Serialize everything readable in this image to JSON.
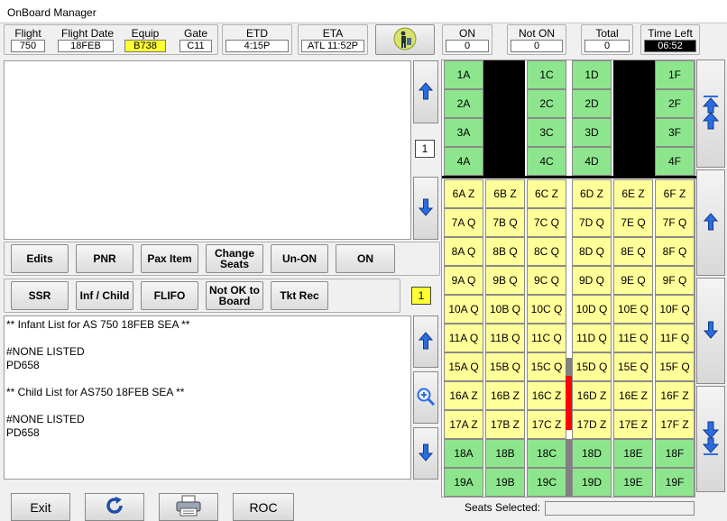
{
  "window": {
    "title": "OnBoard Manager"
  },
  "header": {
    "flight_label": "Flight",
    "flight_value": "750",
    "flight_date_label": "Flight Date",
    "flight_date_value": "18FEB",
    "equip_label": "Equip",
    "equip_value": "B738",
    "gate_label": "Gate",
    "gate_value": "C11",
    "etd_label": "ETD",
    "etd_value": "4:15P",
    "eta_label": "ETA",
    "eta_value": "ATL 11:52P",
    "on_label": "ON",
    "on_value": "0",
    "not_on_label": "Not ON",
    "not_on_value": "0",
    "total_label": "Total",
    "total_value": "0",
    "time_left_label": "Time Left",
    "time_left_value": "06:52",
    "boarding_icon": "passenger-boarding-icon"
  },
  "pager": {
    "top_page": "1",
    "mid_page": "1"
  },
  "buttons_row1": [
    {
      "label": "Edits"
    },
    {
      "label": "PNR"
    },
    {
      "label": "Pax Item"
    },
    {
      "label": "Change Seats"
    },
    {
      "label": "Un-ON"
    },
    {
      "label": "ON"
    }
  ],
  "buttons_row2": [
    {
      "label": "SSR"
    },
    {
      "label": "Inf / Child"
    },
    {
      "label": "FLIFO"
    },
    {
      "label": "Not OK to Board"
    },
    {
      "label": "Tkt Rec"
    }
  ],
  "info_panel": {
    "lines": [
      "** Infant List for AS 750 18FEB SEA **",
      "",
      "#NONE LISTED",
      "PD658",
      "",
      "** Child List for AS750 18FEB SEA **",
      "",
      "#NONE LISTED",
      "PD658"
    ]
  },
  "seatmap": {
    "first_class": [
      [
        "1A",
        "1C",
        "1D",
        "1F"
      ],
      [
        "2A",
        "2C",
        "2D",
        "2F"
      ],
      [
        "3A",
        "3C",
        "3D",
        "3F"
      ],
      [
        "4A",
        "4C",
        "4D",
        "4F"
      ]
    ],
    "main_cabin": [
      [
        "6A Z",
        "6B Z",
        "6C Z",
        "6D Z",
        "6E Z",
        "6F Z"
      ],
      [
        "7A Q",
        "7B Q",
        "7C Q",
        "7D Q",
        "7E Q",
        "7F Q"
      ],
      [
        "8A Q",
        "8B Q",
        "8C Q",
        "8D Q",
        "8E Q",
        "8F Q"
      ],
      [
        "9A Q",
        "9B Q",
        "9C Q",
        "9D Q",
        "9E Q",
        "9F Q"
      ],
      [
        "10A Q",
        "10B Q",
        "10C Q",
        "10D Q",
        "10E Q",
        "10F Q"
      ],
      [
        "11A Q",
        "11B Q",
        "11C Q",
        "11D Q",
        "11E Q",
        "11F Q"
      ],
      [
        "15A Q",
        "15B Q",
        "15C Q",
        "15D Q",
        "15E Q",
        "15F Q"
      ],
      [
        "16A Z",
        "16B Z",
        "16C Z",
        "16D Z",
        "16E Z",
        "16F Z"
      ],
      [
        "17A Z",
        "17B Z",
        "17C Z",
        "17D Z",
        "17E Z",
        "17F Z"
      ],
      [
        "18A",
        "18B",
        "18C",
        "18D",
        "18E",
        "18F"
      ],
      [
        "19A",
        "19B",
        "19C",
        "19D",
        "19E",
        "19F"
      ]
    ],
    "seats_selected_label": "Seats Selected:",
    "seats_selected_value": "",
    "colors": {
      "first": "#8de68d",
      "main": "#ffff99",
      "rear": "#8de68d",
      "exit_marker": "#ff0000"
    }
  },
  "bottom": {
    "exit_label": "Exit",
    "refresh_icon": "refresh-icon",
    "print_icon": "printer-icon",
    "roc_label": "ROC"
  }
}
